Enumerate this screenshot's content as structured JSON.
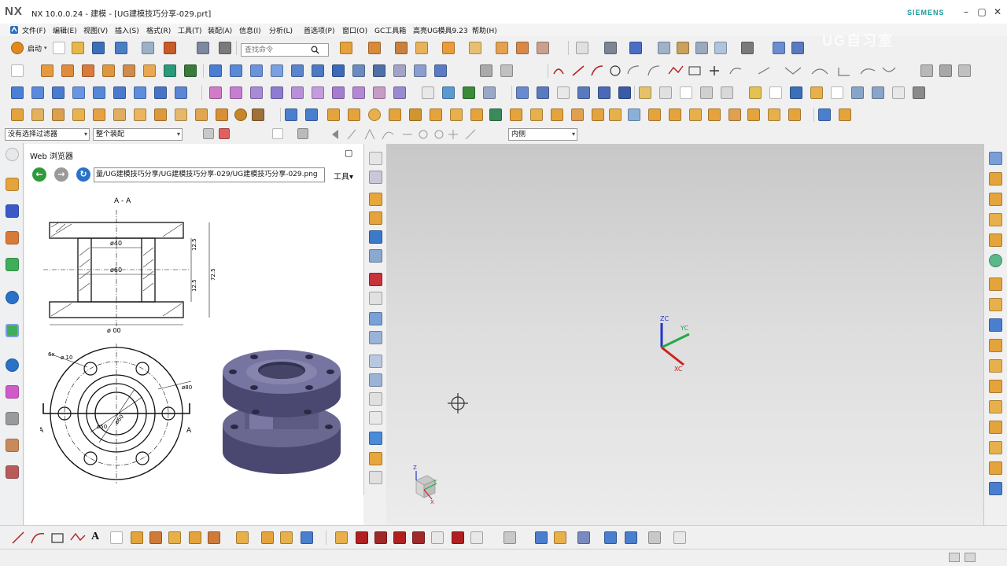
{
  "window": {
    "app_logo": "NX",
    "title": "NX 10.0.0.24 - 建模 - [UG建模技巧分享-029.prt]",
    "brand": "SIEMENS",
    "minimize_icon": "minimize-icon",
    "restore_icon": "restore-icon",
    "close_icon": "close-icon"
  },
  "menu": {
    "items": [
      "文件(F)",
      "编辑(E)",
      "视图(V)",
      "插入(S)",
      "格式(R)",
      "工具(T)",
      "装配(A)",
      "信息(I)",
      "分析(L)",
      "首选项(P)",
      "窗口(O)",
      "GC工具箱",
      "高亮UG模具9.23",
      "帮助(H)"
    ]
  },
  "toolbar": {
    "start_label": "启动",
    "command_search_placeholder": "查找命令"
  },
  "selection": {
    "filter_value": "没有选择过滤器",
    "scope_value": "整个装配",
    "snap_value": "内侧"
  },
  "resource_bar": {
    "icons": [
      "settings-icon",
      "assembly-navigator-icon",
      "constraint-navigator-icon",
      "part-navigator-icon",
      "reuse-library-icon",
      "hd3d-tools-icon",
      "web-browser-icon",
      "history-icon",
      "visualization-icon",
      "roles-icon",
      "system-scenes-icon",
      "manufacturing-wizard-icon"
    ]
  },
  "web_browser": {
    "title": "Web 浏览器",
    "url": "量/UG建模技巧分享/UG建模技巧分享-029/UG建模技巧分享-029.png",
    "tools_label": "工具"
  },
  "drawing": {
    "section_label": "A - A",
    "dim_phi40": "ø40",
    "dim_phi60": "ø60",
    "dim_phi100": "ø 00",
    "dim_12_5_top": "12.5",
    "dim_12_5_bottom": "12.5",
    "dim_72_5": "72.5",
    "holes_label": "6x",
    "dim_phi10": "ø 10",
    "dim_phi80": "ø80",
    "dim_phi50": "ø50",
    "dim_phi60_plan": "ø60",
    "cut_mark_a_left": "A",
    "cut_mark_a_right": "A"
  },
  "viewport": {
    "watermark": "UG自习室",
    "triad_zc": "ZC",
    "triad_yc": "YC",
    "triad_xc": "XC",
    "mini_z": "Z",
    "mini_y": "Y",
    "mini_x": "X"
  },
  "colors": {
    "viewport_top": "#c8c8c8",
    "viewport_bottom": "#ececec",
    "axis_x": "#cc2222",
    "axis_y": "#22aa44",
    "axis_z": "#2233cc",
    "part_body": "#5d5b84",
    "brand_teal": "#1a9a9a",
    "nav_back": "#2f9a3c",
    "nav_forward": "#9a9a9a",
    "nav_refresh": "#2a72c8"
  }
}
